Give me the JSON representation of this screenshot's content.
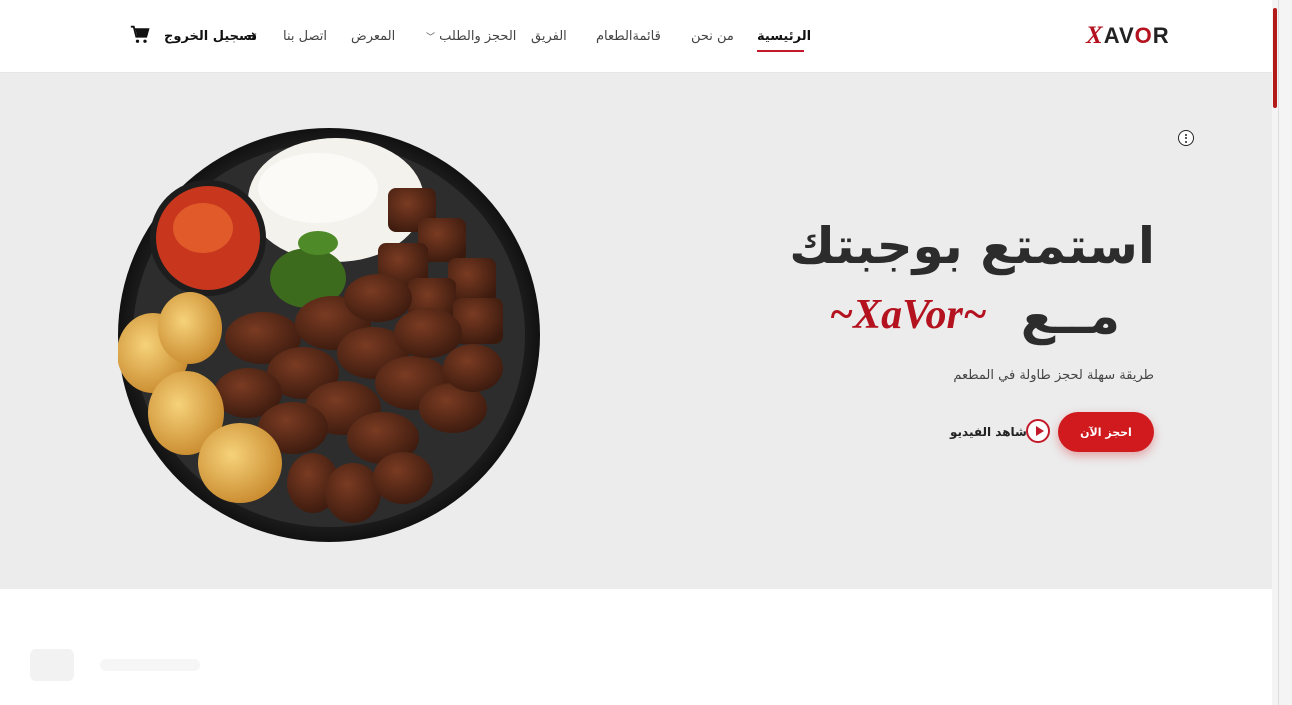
{
  "header": {
    "logo": {
      "x": "X",
      "av": "AV",
      "o": "O",
      "r": "R"
    },
    "nav": [
      {
        "label": "الرئيسية",
        "active": true
      },
      {
        "label": "من نحن"
      },
      {
        "label": "قائمةالطعام"
      },
      {
        "label": "الفريق"
      },
      {
        "label": "الحجز والطلب",
        "dropdown": true
      },
      {
        "label": "المعرض"
      },
      {
        "label": "اتصل بنا"
      }
    ],
    "logout_label": "تسجيل الخروج",
    "icons": {
      "logout": "logout-icon",
      "cart": "cart-icon",
      "chevron": "chevron-down-icon"
    }
  },
  "hero": {
    "headline_line1": "استمتع بوجبتك",
    "headline_line2": "مــع",
    "brand_script": "~XaVor~",
    "subtitle": "طريقة سهلة لحجز طاولة في المطعم",
    "book_button": "احجز الآن",
    "watch_video": "شاهد الفيديو",
    "image": "grilled-kebab-plate",
    "icons": {
      "more": "more-options-icon",
      "play": "play-icon"
    }
  },
  "colors": {
    "accent": "#d01a1e",
    "brand_red": "#b3121e",
    "hero_bg": "#ececed",
    "text_dark": "#2c2c2c"
  }
}
